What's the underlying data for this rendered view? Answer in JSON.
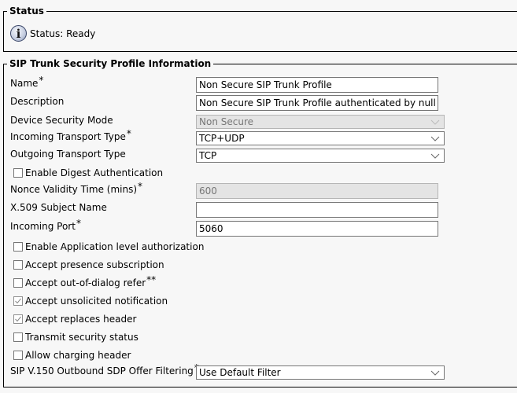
{
  "status": {
    "legend": "Status",
    "icon": "info-icon",
    "text": "Status: Ready"
  },
  "info": {
    "legend": "SIP Trunk Security Profile Information",
    "fields": {
      "name": {
        "label": "Name",
        "required": "*",
        "value": "Non Secure SIP Trunk Profile"
      },
      "description": {
        "label": "Description",
        "value": "Non Secure SIP Trunk Profile authenticated by null St"
      },
      "device_security_mode": {
        "label": "Device Security Mode",
        "value": "Non Secure",
        "disabled": true
      },
      "incoming_transport_type": {
        "label": "Incoming Transport Type",
        "required": "*",
        "value": "TCP+UDP"
      },
      "outgoing_transport_type": {
        "label": "Outgoing Transport Type",
        "value": "TCP"
      },
      "enable_digest_auth": {
        "label": "Enable Digest Authentication",
        "checked": false
      },
      "nonce_validity_time": {
        "label": "Nonce Validity Time (mins)",
        "required": "*",
        "value": "600",
        "disabled": true
      },
      "x509_subject_name": {
        "label": "X.509 Subject Name",
        "value": ""
      },
      "incoming_port": {
        "label": "Incoming Port",
        "required": "*",
        "value": "5060"
      },
      "enable_app_level_auth": {
        "label": "Enable Application level authorization",
        "checked": false
      },
      "accept_presence_subscription": {
        "label": "Accept presence subscription",
        "checked": false
      },
      "accept_out_of_dialog_refer": {
        "label": "Accept out-of-dialog refer",
        "required": "**",
        "checked": false
      },
      "accept_unsolicited_notification": {
        "label": "Accept unsolicited notification",
        "checked": true
      },
      "accept_replaces_header": {
        "label": "Accept replaces header",
        "checked": true
      },
      "transmit_security_status": {
        "label": "Transmit security status",
        "checked": false
      },
      "allow_charging_header": {
        "label": "Allow charging header",
        "checked": false
      },
      "sdp_offer_filtering": {
        "label": "SIP V.150 Outbound SDP Offer Filtering",
        "required": "*",
        "value": "Use Default Filter"
      }
    }
  }
}
